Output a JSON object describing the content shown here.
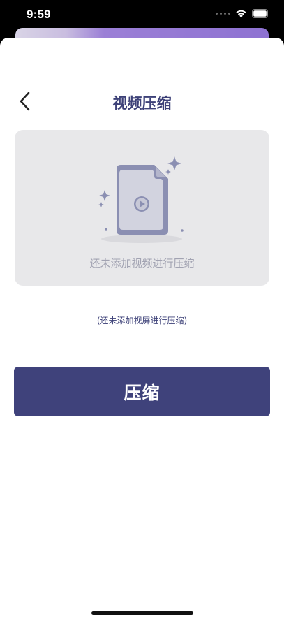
{
  "status_bar": {
    "time": "9:59",
    "icons": [
      "signal-dots-icon",
      "wifi-icon",
      "battery-icon"
    ]
  },
  "nav": {
    "back_icon": "chevron-left-icon",
    "title": "视频压缩"
  },
  "drop_area": {
    "icon": "video-file-icon",
    "label": "还未添加视频进行压缩"
  },
  "hint": "(还未添加视屏进行压缩)",
  "compress_button": {
    "label": "压缩"
  },
  "colors": {
    "primary": "#3f427b",
    "title": "#3d4178",
    "drop_bg": "#e8e8ea",
    "illustration": "#8b8fb2",
    "muted_text": "#a2a3b2"
  }
}
